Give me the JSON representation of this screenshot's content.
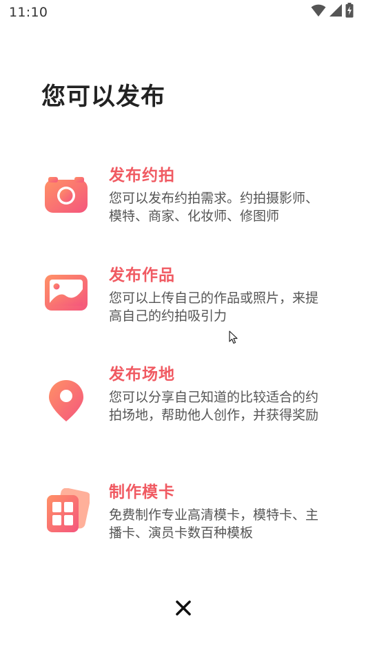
{
  "status_bar": {
    "time": "11:10",
    "icons": [
      "wifi-icon",
      "signal-icon",
      "battery-icon"
    ]
  },
  "page": {
    "title": "您可以发布"
  },
  "options": [
    {
      "title": "发布约拍",
      "description": "您可以发布约拍需求。约拍摄影师、模特、商家、化妆师、修图师",
      "icon": "camera-icon"
    },
    {
      "title": "发布作品",
      "description": "您可以上传自己的作品或照片，来提高自己的约拍吸引力",
      "icon": "image-icon"
    },
    {
      "title": "发布场地",
      "description": "您可以分享自己知道的比较适合的约拍场地，帮助他人创作，并获得奖励",
      "icon": "location-pin-icon"
    },
    {
      "title": "制作模卡",
      "description": "免费制作专业高清模卡，模特卡、主播卡、演员卡数百种模板",
      "icon": "model-card-icon"
    }
  ],
  "close": {
    "icon": "close-icon"
  },
  "colors": {
    "accent": "#f05a62",
    "icon_gradient_start": "#ff8a6b",
    "icon_gradient_end": "#f45c7a"
  }
}
